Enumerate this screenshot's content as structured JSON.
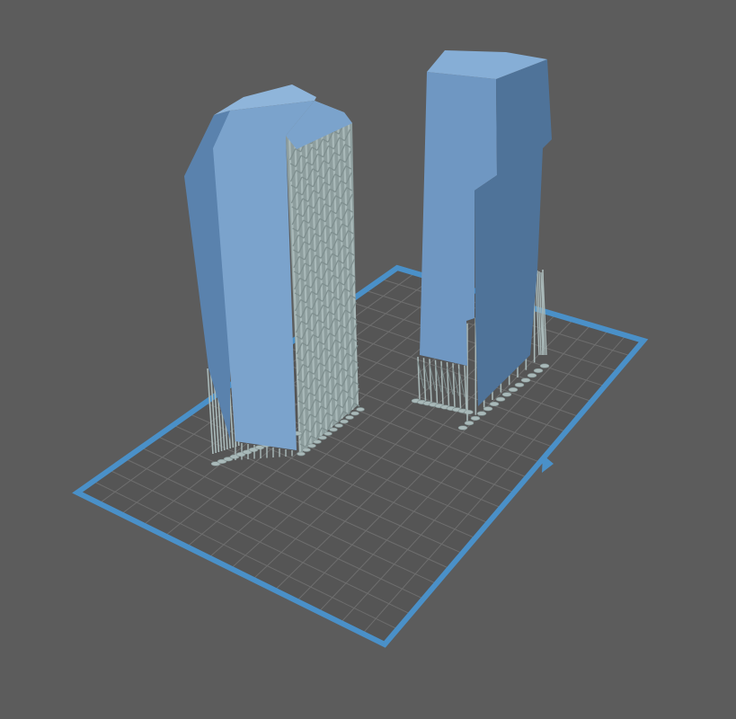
{
  "viewport": {
    "background_color": "#5c5c5c"
  },
  "build_plate": {
    "border_color": "#4a90c8",
    "fill_color": "#555555",
    "grid_color": "#6e6e6e",
    "grid_cells_a": 20,
    "grid_cells_b": 14
  },
  "models": [
    {
      "name": "model-left",
      "color": "#7ba3cc",
      "shade_color": "#5a82ad",
      "top_color": "#8fb5da",
      "supports": true
    },
    {
      "name": "model-right",
      "color": "#6f97c2",
      "shade_color": "#4f7399",
      "top_color": "#86aed6",
      "supports": true
    }
  ],
  "supports": {
    "color": "#a9b9b9",
    "dark_color": "#7f8f8f"
  },
  "icons": {
    "front_indicator": "front-direction-arrow-icon"
  }
}
